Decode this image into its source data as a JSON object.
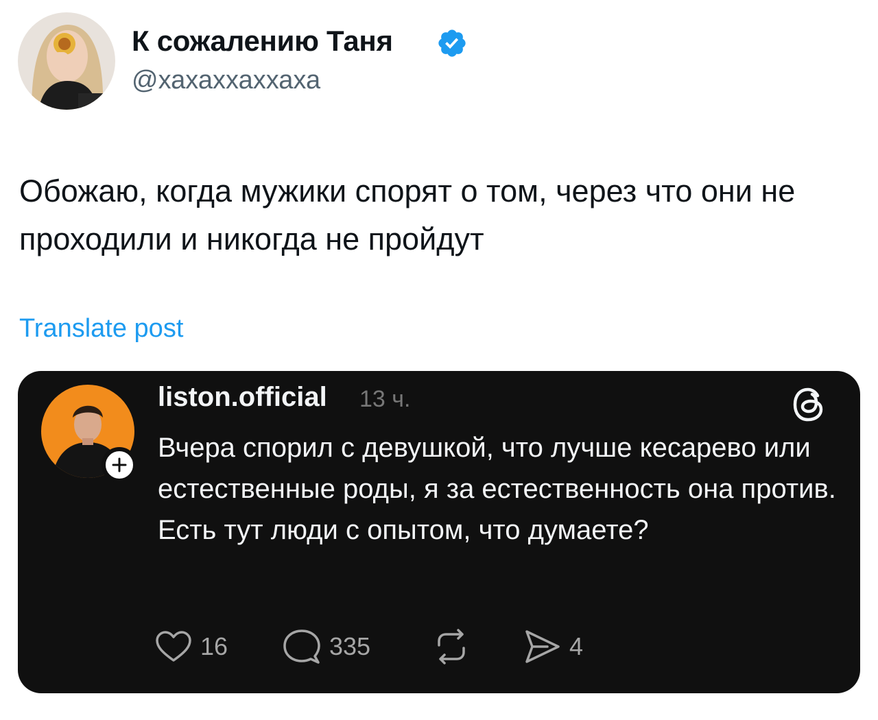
{
  "tweet": {
    "author": {
      "display_name": "К сожалению Таня",
      "handle": "@хахаххаххаха",
      "verified": true
    },
    "text": "Обожаю, когда мужики спорят о том, через что они не проходили и никогда не пройдут",
    "translate_label": "Translate post"
  },
  "embedded_post": {
    "platform_icon": "threads-icon",
    "username": "liston.official",
    "time": "13 ч.",
    "text": "Вчера спорил с девушкой, что лучше кесарево или естественные роды, я за естественность она против. Есть тут люди с опытом, что думаете?",
    "actions": {
      "likes": "16",
      "replies": "335",
      "shares": "4"
    }
  },
  "colors": {
    "accent": "#1d9bf0",
    "card_background": "#101010",
    "embed_avatar_background": "#f28c1c",
    "text_primary": "#0f1419",
    "text_secondary": "#536471"
  }
}
